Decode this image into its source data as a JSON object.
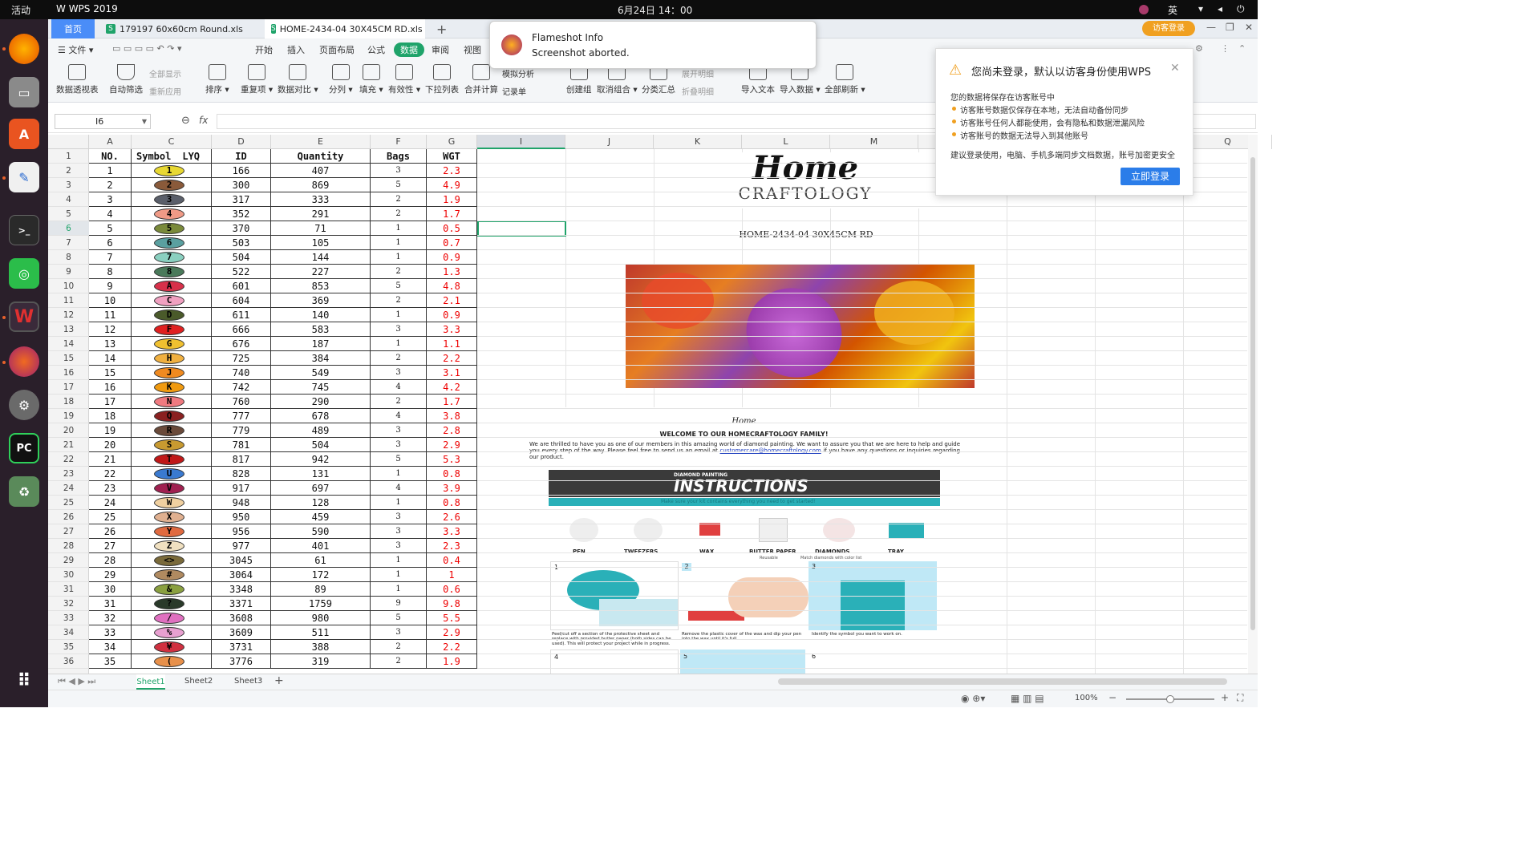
{
  "topbar": {
    "activities": "活动",
    "app": "WPS 2019",
    "datetime": "6月24日 14：00",
    "input_method": "英"
  },
  "tabs": [
    {
      "label": "首页"
    },
    {
      "label": "179197 60x60cm Round.xls"
    },
    {
      "label": "HOME-2434-04 30X45CM RD.xls"
    }
  ],
  "guest_login": "访客登录",
  "menu": {
    "file": "文件",
    "items": [
      "开始",
      "插入",
      "页面布局",
      "公式",
      "数据",
      "审阅",
      "视图"
    ],
    "active": "数据"
  },
  "ribbon": {
    "buttons": [
      "数据透视表",
      "自动筛选",
      "排序",
      "重复项",
      "数据对比",
      "分列",
      "填充",
      "有效性",
      "下拉列表",
      "合并计算",
      "记录单",
      "创建组",
      "取消组合",
      "分类汇总",
      "导入文本",
      "导入数据",
      "全部刷新"
    ],
    "small": [
      "全部显示",
      "重新应用",
      "模拟分析",
      "展开明细",
      "折叠明细"
    ]
  },
  "formula": {
    "cellref": "I6",
    "fx": "fx",
    "value": ""
  },
  "columns": [
    "A",
    "C",
    "D",
    "E",
    "F",
    "G",
    "I",
    "J",
    "K",
    "L",
    "M",
    "Q"
  ],
  "headers": {
    "no": "NO.",
    "symbol": "Symbol",
    "lyq": "LYQ",
    "id": "ID",
    "qty": "Quantity",
    "bags": "Bags",
    "wgt": "WGT"
  },
  "rows": [
    {
      "r": "1"
    },
    {
      "r": "2",
      "no": "1",
      "sym": "1",
      "color": "#e8d832",
      "id": "166",
      "qty": "407",
      "bags": "3",
      "wgt": "2.3"
    },
    {
      "r": "3",
      "no": "2",
      "sym": "2",
      "color": "#8a5a3a",
      "id": "300",
      "qty": "869",
      "bags": "5",
      "wgt": "4.9"
    },
    {
      "r": "4",
      "no": "3",
      "sym": "3",
      "color": "#5a5f6a",
      "id": "317",
      "qty": "333",
      "bags": "2",
      "wgt": "1.9"
    },
    {
      "r": "5",
      "no": "4",
      "sym": "4",
      "color": "#f09a86",
      "id": "352",
      "qty": "291",
      "bags": "2",
      "wgt": "1.7"
    },
    {
      "r": "6",
      "no": "5",
      "sym": "5",
      "color": "#7a8a3a",
      "id": "370",
      "qty": "71",
      "bags": "1",
      "wgt": "0.5"
    },
    {
      "r": "7",
      "no": "6",
      "sym": "6",
      "color": "#5aa0a0",
      "id": "503",
      "qty": "105",
      "bags": "1",
      "wgt": "0.7"
    },
    {
      "r": "8",
      "no": "7",
      "sym": "7",
      "color": "#8ad0c0",
      "id": "504",
      "qty": "144",
      "bags": "1",
      "wgt": "0.9"
    },
    {
      "r": "9",
      "no": "8",
      "sym": "8",
      "color": "#4a7a5a",
      "id": "522",
      "qty": "227",
      "bags": "2",
      "wgt": "1.3"
    },
    {
      "r": "10",
      "no": "9",
      "sym": "A",
      "color": "#d8304a",
      "id": "601",
      "qty": "853",
      "bags": "5",
      "wgt": "4.8"
    },
    {
      "r": "11",
      "no": "10",
      "sym": "C",
      "color": "#f0a0c0",
      "id": "604",
      "qty": "369",
      "bags": "2",
      "wgt": "2.1"
    },
    {
      "r": "12",
      "no": "11",
      "sym": "D",
      "color": "#4a5a2a",
      "id": "611",
      "qty": "140",
      "bags": "1",
      "wgt": "0.9"
    },
    {
      "r": "13",
      "no": "12",
      "sym": "F",
      "color": "#e02020",
      "id": "666",
      "qty": "583",
      "bags": "3",
      "wgt": "3.3"
    },
    {
      "r": "14",
      "no": "13",
      "sym": "G",
      "color": "#f0c030",
      "id": "676",
      "qty": "187",
      "bags": "1",
      "wgt": "1.1"
    },
    {
      "r": "15",
      "no": "14",
      "sym": "H",
      "color": "#f0b040",
      "id": "725",
      "qty": "384",
      "bags": "2",
      "wgt": "2.2"
    },
    {
      "r": "16",
      "no": "15",
      "sym": "J",
      "color": "#f08a20",
      "id": "740",
      "qty": "549",
      "bags": "3",
      "wgt": "3.1"
    },
    {
      "r": "17",
      "no": "16",
      "sym": "K",
      "color": "#f09a10",
      "id": "742",
      "qty": "745",
      "bags": "4",
      "wgt": "4.2"
    },
    {
      "r": "18",
      "no": "17",
      "sym": "N",
      "color": "#f07a80",
      "id": "760",
      "qty": "290",
      "bags": "2",
      "wgt": "1.7"
    },
    {
      "r": "19",
      "no": "18",
      "sym": "Q",
      "color": "#8a2020",
      "id": "777",
      "qty": "678",
      "bags": "4",
      "wgt": "3.8"
    },
    {
      "r": "20",
      "no": "19",
      "sym": "R",
      "color": "#6a4a3a",
      "id": "779",
      "qty": "489",
      "bags": "3",
      "wgt": "2.8"
    },
    {
      "r": "21",
      "no": "20",
      "sym": "S",
      "color": "#c89a30",
      "id": "781",
      "qty": "504",
      "bags": "3",
      "wgt": "2.9"
    },
    {
      "r": "22",
      "no": "21",
      "sym": "T",
      "color": "#c01818",
      "id": "817",
      "qty": "942",
      "bags": "5",
      "wgt": "5.3"
    },
    {
      "r": "23",
      "no": "22",
      "sym": "U",
      "color": "#3a7ad0",
      "id": "828",
      "qty": "131",
      "bags": "1",
      "wgt": "0.8"
    },
    {
      "r": "24",
      "no": "23",
      "sym": "V",
      "color": "#a02050",
      "id": "917",
      "qty": "697",
      "bags": "4",
      "wgt": "3.9"
    },
    {
      "r": "25",
      "no": "24",
      "sym": "W",
      "color": "#f0d0a0",
      "id": "948",
      "qty": "128",
      "bags": "1",
      "wgt": "0.8"
    },
    {
      "r": "26",
      "no": "25",
      "sym": "X",
      "color": "#e0b090",
      "id": "950",
      "qty": "459",
      "bags": "3",
      "wgt": "2.6"
    },
    {
      "r": "27",
      "no": "26",
      "sym": "Y",
      "color": "#e06a40",
      "id": "956",
      "qty": "590",
      "bags": "3",
      "wgt": "3.3"
    },
    {
      "r": "28",
      "no": "27",
      "sym": "Z",
      "color": "#f0e0c0",
      "id": "977",
      "qty": "401",
      "bags": "3",
      "wgt": "2.3"
    },
    {
      "r": "29",
      "no": "28",
      "sym": "<>",
      "color": "#7a6a3a",
      "id": "3045",
      "qty": "61",
      "bags": "1",
      "wgt": "0.4"
    },
    {
      "r": "30",
      "no": "29",
      "sym": "#",
      "color": "#b08a60",
      "id": "3064",
      "qty": "172",
      "bags": "1",
      "wgt": "1"
    },
    {
      "r": "31",
      "no": "30",
      "sym": "&",
      "color": "#8aa040",
      "id": "3348",
      "qty": "89",
      "bags": "1",
      "wgt": "0.6"
    },
    {
      "r": "32",
      "no": "31",
      "sym": "?",
      "color": "#2a3a2a",
      "id": "3371",
      "qty": "1759",
      "bags": "9",
      "wgt": "9.8"
    },
    {
      "r": "33",
      "no": "32",
      "sym": "/",
      "color": "#e070c0",
      "id": "3608",
      "qty": "980",
      "bags": "5",
      "wgt": "5.5"
    },
    {
      "r": "34",
      "no": "33",
      "sym": "%",
      "color": "#e8a0d0",
      "id": "3609",
      "qty": "511",
      "bags": "3",
      "wgt": "2.9"
    },
    {
      "r": "35",
      "no": "34",
      "sym": "¥",
      "color": "#d03040",
      "id": "3731",
      "qty": "388",
      "bags": "2",
      "wgt": "2.2"
    },
    {
      "r": "36",
      "no": "35",
      "sym": "(",
      "color": "#e8904a",
      "id": "3776",
      "qty": "319",
      "bags": "2",
      "wgt": "1.9"
    }
  ],
  "product_code": "HOME-2434-04 30X45CM RD",
  "logo": {
    "script": "Home",
    "caps": "CRAFTOLOGY"
  },
  "instructions": {
    "welcome": "WELCOME TO OUR HOMECRAFTOLOGY FAMILY!",
    "para": "We are thrilled to have you as one of our members in this amazing world of diamond painting. We want to assure you that we are here to help and guide you every step of the way. Please feel free to send us an email at",
    "email": "customercare@homecraftology.com",
    "para2": "if you have any questions or inquiries regarding our product.",
    "banner_small": "DIAMOND PAINTING",
    "banner": "INSTRUCTIONS",
    "check": "Make sure your kit contains everything you need to get started!",
    "tools": [
      "PEN",
      "TWEEZERS",
      "WAX",
      "BUTTER PAPER",
      "DIAMONDS",
      "TRAY"
    ],
    "tool_notes": [
      "",
      "",
      "",
      "Reusable",
      "Match diamonds with color list",
      ""
    ],
    "steps": [
      "1",
      "2",
      "3",
      "4",
      "5",
      "6"
    ],
    "step_text": [
      "Peel/cut off a section of the protective sheet and replace with provided butter paper (both sides can be used). This will protect your project while in progress.",
      "Remove the plastic cover of the wax and dip your pen into the wax until it's full.",
      "Identify the symbol you want to work on."
    ]
  },
  "flameshot": {
    "title": "Flameshot Info",
    "msg": "Screenshot aborted."
  },
  "login_popup": {
    "title": "您尚未登录，默认以访客身份使用WPS",
    "sub": "您的数据将保存在访客账号中",
    "bullets": [
      "访客账号数据仅保存在本地，无法自动备份同步",
      "访客账号任何人都能使用，会有隐私和数据泄漏风险",
      "访客账号的数据无法导入到其他账号"
    ],
    "foot": "建议登录使用，电脑、手机多端同步文档数据，账号加密更安全",
    "button": "立即登录"
  },
  "sheets": [
    "Sheet1",
    "Sheet2",
    "Sheet3"
  ],
  "zoom": "100%",
  "colors": {
    "accent": "#1fa36a",
    "wps_blue": "#3b82f6",
    "tab_blue": "#4a8df8",
    "login_btn": "#2b7de9",
    "wgt_red": "#e00000"
  }
}
